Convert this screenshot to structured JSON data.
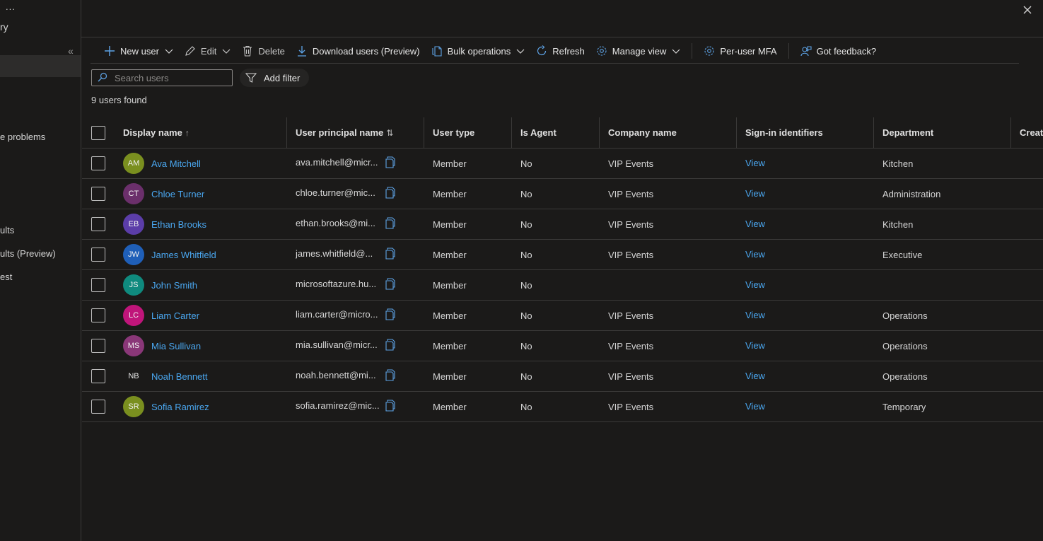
{
  "sidebar": {
    "dots": "...",
    "title": "ry",
    "collapse": "«",
    "items": [
      "e problems",
      "ults",
      "ults (Preview)",
      "est"
    ]
  },
  "toolbar": {
    "new_user": "New user",
    "edit": "Edit",
    "delete": "Delete",
    "download": "Download users (Preview)",
    "bulk": "Bulk operations",
    "refresh": "Refresh",
    "manage_view": "Manage view",
    "per_user_mfa": "Per-user MFA",
    "feedback": "Got feedback?"
  },
  "search": {
    "placeholder": "Search users"
  },
  "filter": {
    "label": "Add filter"
  },
  "result_count": "9 users found",
  "columns": {
    "display_name": "Display name",
    "display_name_sort": "↑",
    "upn": "User principal name",
    "upn_sort": "⇅",
    "user_type": "User type",
    "is_agent": "Is Agent",
    "company": "Company name",
    "signin": "Sign-in identifiers",
    "department": "Department",
    "created": "Creati"
  },
  "users": [
    {
      "initials": "AM",
      "name": "Ava Mitchell",
      "upn": "ava.mitchell@micr...",
      "type": "Member",
      "agent": "No",
      "company": "VIP Events",
      "signin": "View",
      "department": "Kitchen",
      "color": "#7a8f1f"
    },
    {
      "initials": "CT",
      "name": "Chloe Turner",
      "upn": "chloe.turner@mic...",
      "type": "Member",
      "agent": "No",
      "company": "VIP Events",
      "signin": "View",
      "department": "Administration",
      "color": "#6b2f6b"
    },
    {
      "initials": "EB",
      "name": "Ethan Brooks",
      "upn": "ethan.brooks@mi...",
      "type": "Member",
      "agent": "No",
      "company": "VIP Events",
      "signin": "View",
      "department": "Kitchen",
      "color": "#5b3da8"
    },
    {
      "initials": "JW",
      "name": "James Whitfield",
      "upn": "james.whitfield@...",
      "type": "Member",
      "agent": "No",
      "company": "VIP Events",
      "signin": "View",
      "department": "Executive",
      "color": "#1f5fb8"
    },
    {
      "initials": "JS",
      "name": "John Smith",
      "upn": "microsoftazure.hu...",
      "type": "Member",
      "agent": "No",
      "company": "",
      "signin": "View",
      "department": "",
      "color": "#0f8a7e"
    },
    {
      "initials": "LC",
      "name": "Liam Carter",
      "upn": "liam.carter@micro...",
      "type": "Member",
      "agent": "No",
      "company": "VIP Events",
      "signin": "View",
      "department": "Operations",
      "color": "#c0157a"
    },
    {
      "initials": "MS",
      "name": "Mia Sullivan",
      "upn": "mia.sullivan@micr...",
      "type": "Member",
      "agent": "No",
      "company": "VIP Events",
      "signin": "View",
      "department": "Operations",
      "color": "#8a3778"
    },
    {
      "initials": "NB",
      "name": "Noah Bennett",
      "upn": "noah.bennett@mi...",
      "type": "Member",
      "agent": "No",
      "company": "VIP Events",
      "signin": "View",
      "department": "Operations",
      "color": ""
    },
    {
      "initials": "SR",
      "name": "Sofia Ramirez",
      "upn": "sofia.ramirez@mic...",
      "type": "Member",
      "agent": "No",
      "company": "VIP Events",
      "signin": "View",
      "department": "Temporary",
      "color": "#7a8f1f"
    }
  ]
}
